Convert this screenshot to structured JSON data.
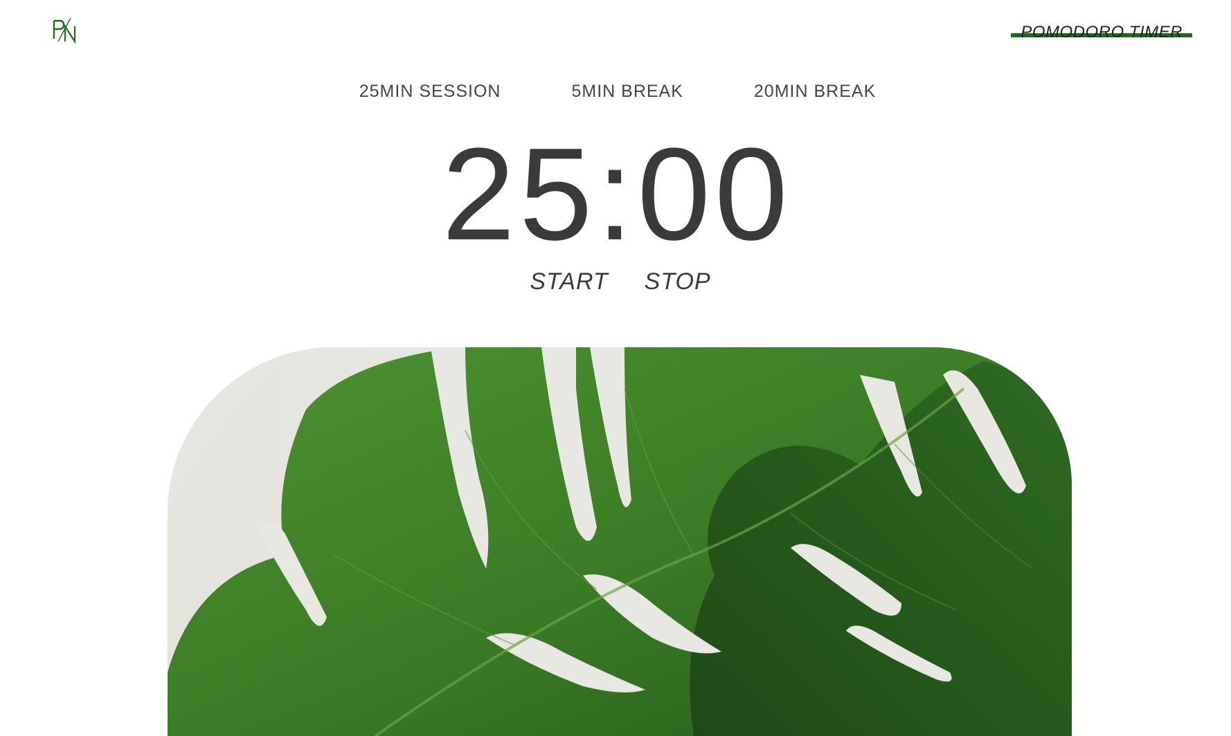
{
  "header": {
    "logo_icon": "pn-monogram-logo",
    "brand_title": "POMODORO TIMER"
  },
  "tabs": [
    {
      "label": "25MIN SESSION"
    },
    {
      "label": "5MIN BREAK"
    },
    {
      "label": "20MIN BREAK"
    }
  ],
  "timer": {
    "display": "25:00"
  },
  "controls": {
    "start_label": "START",
    "stop_label": "STOP"
  },
  "hero": {
    "image": "monstera-leaf-photo"
  },
  "colors": {
    "accent_green": "#1e6a1e",
    "text_dark": "#3a3a3a",
    "background": "#ffffff",
    "photo_background": "#ebeae5",
    "leaf_green": "#3f7f2a"
  }
}
